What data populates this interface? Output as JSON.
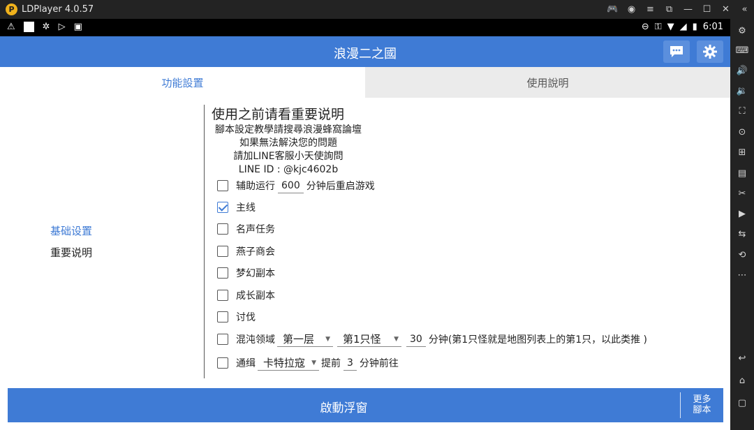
{
  "window": {
    "title": "LDPlayer 4.0.57"
  },
  "statusbar": {
    "time": "6:01"
  },
  "app": {
    "title": "浪漫二之國",
    "tabs": [
      {
        "label": "功能設置",
        "active": true
      },
      {
        "label": "使用說明",
        "active": false
      }
    ],
    "nav": {
      "items": [
        "基础设置",
        "重要说明"
      ],
      "selected": "基础设置"
    },
    "content": {
      "heading": "使用之前请看重要说明",
      "info": [
        "腳本設定教學請搜尋浪漫蜂窩論壇",
        "如果無法解決您的問題",
        "請加LINE客服小天使詢問",
        "LINE ID : @kjc4602b"
      ],
      "rows": [
        {
          "checked": false,
          "label": "辅助运行",
          "value": "600",
          "suffix": "分钟后重启游戏"
        },
        {
          "checked": true,
          "label": "主线"
        },
        {
          "checked": false,
          "label": "名声任务"
        },
        {
          "checked": false,
          "label": "燕子商会"
        },
        {
          "checked": false,
          "label": "梦幻副本"
        },
        {
          "checked": false,
          "label": "成长副本"
        },
        {
          "checked": false,
          "label": "讨伐"
        },
        {
          "checked": false,
          "label": "混沌领域",
          "select1": "第一层",
          "select2": "第1只怪",
          "value": "30",
          "suffix": "分钟(第1只怪就是地图列表上的第1只，以此类推 )"
        },
        {
          "checked": false,
          "label": "通缉",
          "select1": "卡特拉寇",
          "prefix2": "提前",
          "value": "3",
          "suffix": "分钟前往"
        }
      ]
    },
    "bottom": {
      "start_label": "啟動浮窗",
      "more_line1": "更多",
      "more_line2": "腳本"
    }
  },
  "colors": {
    "accent": "#3f7bd5",
    "titlebar": "#232323"
  },
  "icons": [
    "chat-icon",
    "gear-icon"
  ]
}
